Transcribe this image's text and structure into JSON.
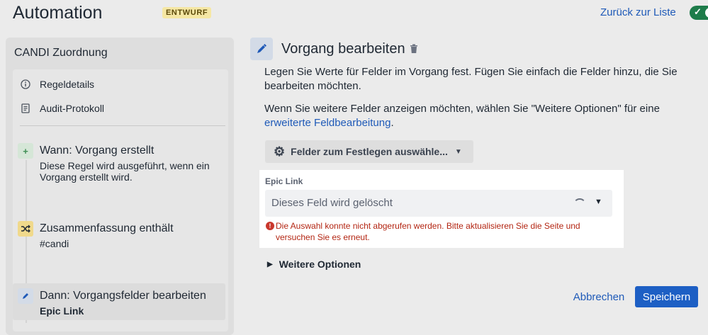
{
  "header": {
    "title": "Automation",
    "status_badge": "ENTWURF",
    "back_link": "Zurück zur Liste",
    "toggle_icon": "checkmark-icon"
  },
  "sidebar": {
    "rule_name": "CANDI Zuordnung",
    "menu": [
      {
        "label": "Regeldetails",
        "icon": "info-icon"
      },
      {
        "label": "Audit-Protokoll",
        "icon": "document-icon"
      }
    ],
    "steps": [
      {
        "title": "Wann: Vorgang erstellt",
        "desc": "Diese Regel wird ausgeführt, wenn ein Vorgang erstellt wird.",
        "icon": "plus-icon",
        "color": "#3f8f55",
        "bg": "#d5e6d7"
      },
      {
        "title": "Zusammenfassung enthält",
        "desc": "#candi",
        "icon": "shuffle-icon",
        "color": "#1f2833",
        "bg": "#f0d98b"
      },
      {
        "title": "Dann: Vorgangsfelder bearbeiten",
        "desc": "Epic Link",
        "icon": "pencil-icon",
        "color": "#1f5ab8",
        "bg": "#d3dbe7"
      }
    ]
  },
  "main": {
    "title": "Vorgang bearbeiten",
    "intro": "Legen Sie Werte für Felder im Vorgang fest. Fügen Sie einfach die Felder hinzu, die Sie bearbeiten möchten.",
    "more_info_prefix": "Wenn Sie weitere Felder anzeigen möchten, wählen Sie \"Weitere Optionen\" für eine ",
    "more_info_link": "erweiterte Feldbearbeitung",
    "more_info_suffix": ".",
    "fields_button": "Felder zum Festlegen auswähle...",
    "field": {
      "label": "Epic Link",
      "value": "Dieses Feld wird gelöscht",
      "error": "Die Auswahl konnte nicht abgerufen werden. Bitte aktualisieren Sie die Seite und versuchen Sie es erneut."
    },
    "more_options": "Weitere Optionen",
    "cancel": "Abbrechen",
    "save": "Speichern"
  },
  "colors": {
    "accent": "#1d5fc4",
    "link": "#1f5ab8",
    "error": "#c9372c",
    "toggle_on": "#1e7c4a"
  }
}
